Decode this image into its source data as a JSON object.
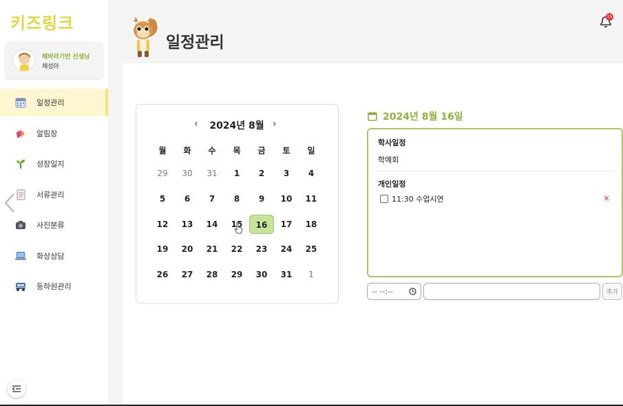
{
  "sidebar": {
    "logo": "키즈링크",
    "profile": {
      "class_label": "해바라기반 선생님",
      "name": "채성아"
    },
    "items": [
      {
        "label": "일정관리",
        "icon": "calendar-icon",
        "active": true
      },
      {
        "label": "알림장",
        "icon": "megaphone-icon"
      },
      {
        "label": "성장일지",
        "icon": "sprout-icon"
      },
      {
        "label": "서류관리",
        "icon": "documents-icon"
      },
      {
        "label": "사진분류",
        "icon": "camera-icon"
      },
      {
        "label": "화상상담",
        "icon": "laptop-icon"
      },
      {
        "label": "등하원관리",
        "icon": "bus-icon"
      }
    ]
  },
  "header": {
    "title": "일정관리",
    "notification_count": "15"
  },
  "calendar": {
    "prev": "‹",
    "next": "›",
    "title": "2024년 8월",
    "weekdays": [
      "월",
      "화",
      "수",
      "목",
      "금",
      "토",
      "일"
    ],
    "weeks": [
      [
        "29",
        "30",
        "31",
        "1",
        "2",
        "3",
        "4"
      ],
      [
        "5",
        "6",
        "7",
        "8",
        "9",
        "10",
        "11"
      ],
      [
        "12",
        "13",
        "14",
        "15",
        "16",
        "17",
        "18"
      ],
      [
        "19",
        "20",
        "21",
        "22",
        "23",
        "24",
        "25"
      ],
      [
        "26",
        "27",
        "28",
        "29",
        "30",
        "31",
        "1"
      ]
    ],
    "selected_day": "16"
  },
  "schedule": {
    "date_title": "2024년 8월 16일",
    "academic_title": "학사일정",
    "academic_item": "학예회",
    "personal_title": "개인일정",
    "personal_item": "11:30 수업시연",
    "delete_label": "×"
  },
  "form": {
    "time_placeholder": "-- --:--",
    "add_label": "추가"
  },
  "colors": {
    "accent_green": "#8db33c",
    "selected_bg": "#c7e39c",
    "logo_yellow": "#e2d640",
    "badge_red": "#e53935"
  }
}
